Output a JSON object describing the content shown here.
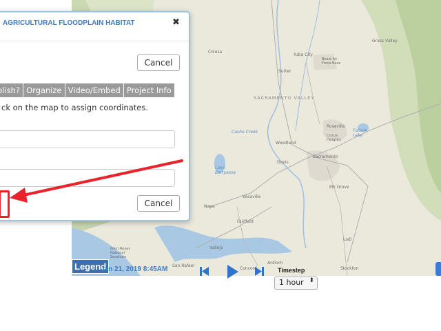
{
  "dialog": {
    "title": "AGRICULTURAL FLOODPLAIN HABITAT",
    "close": "✖",
    "cancel_top": "Cancel",
    "cancel_bottom": "Cancel",
    "tabs": [
      "blish?",
      "Organize",
      "Video/Embed",
      "Project Info"
    ],
    "instructions": "ck on the map to assign coordinates.",
    "field1_value": "",
    "field2_value": ""
  },
  "map": {
    "legend": "Legend",
    "labels": {
      "yuba_city": "Yuba City",
      "beale": "Beale Air Force Base",
      "grass_valley": "Grass Valley",
      "colusa": "Colusa",
      "sutter": "Sutter",
      "sac_valley": "SACRAMENTO VALLEY",
      "roseville": "Roseville",
      "citrus": "Citrus Heights",
      "folsom": "Folsom Lake",
      "woodland": "Woodland",
      "davis": "Davis",
      "sacramento": "Sacramento",
      "elk_grove": "Elk Grove",
      "vacaville": "Vacaville",
      "napa": "Napa",
      "fairfield": "Fairfield",
      "lodi": "Lodi",
      "vallejo": "Vallejo",
      "san_rafael": "San Rafael",
      "concord": "Concord",
      "antioch": "Antioch",
      "stockton": "Stockton",
      "lake_berryessa": "Lake Berryessa",
      "point_reyes": "Point Reyes National Seashore",
      "cache_creek": "Cache Creek"
    }
  },
  "controls": {
    "date": "Jan 21, 2019 8:45AM",
    "timestep_label": "Timestep",
    "timestep_value": "1 hour",
    "timestep_arrows": "⬍"
  },
  "colors": {
    "accent": "#3c7bbf",
    "arrow": "#e8232b",
    "tab": "#9a9a9a"
  }
}
